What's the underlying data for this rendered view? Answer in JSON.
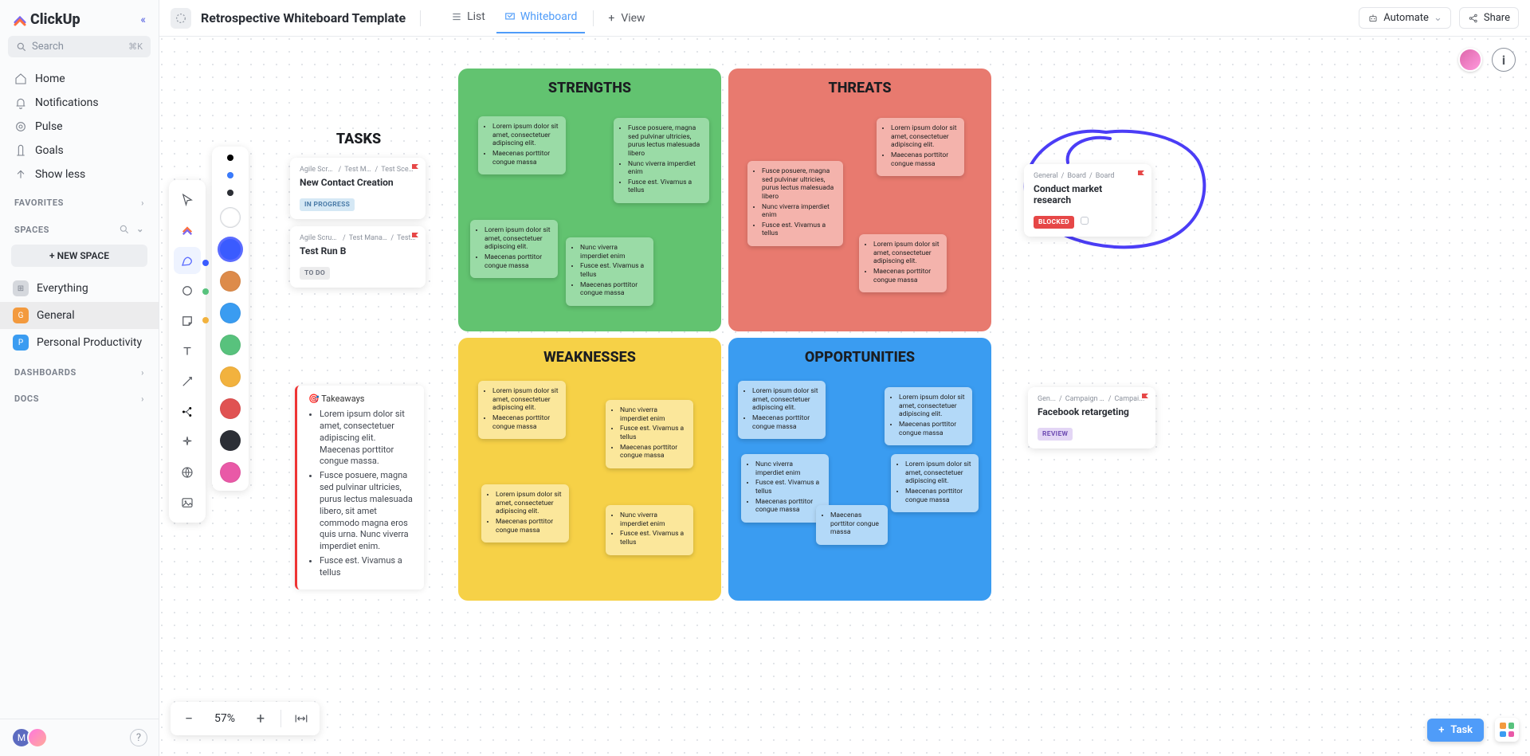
{
  "brand": "ClickUp",
  "search": {
    "placeholder": "Search",
    "shortcut": "⌘K"
  },
  "nav": {
    "home": "Home",
    "notifications": "Notifications",
    "pulse": "Pulse",
    "goals": "Goals",
    "showless": "Show less"
  },
  "sections": {
    "favorites": "FAVORITES",
    "spaces": "SPACES",
    "newspace": "+ NEW SPACE",
    "dashboards": "DASHBOARDS",
    "docs": "DOCS"
  },
  "spaces": {
    "everything": "Everything",
    "general": "General",
    "personal": "Personal Productivity"
  },
  "header": {
    "title": "Retrospective Whiteboard Template",
    "views": {
      "list": "List",
      "whiteboard": "Whiteboard",
      "add": "View"
    },
    "automate": "Automate",
    "share": "Share"
  },
  "zoom": {
    "value": "57%"
  },
  "fab": {
    "task": "Task"
  },
  "tasks": {
    "title": "TASKS",
    "card1": {
      "crumb1": "Agile Scrum ...",
      "crumb2": "Test Man...",
      "crumb3": "Test Scenari...",
      "title": "New Contact Creation",
      "status": "IN PROGRESS"
    },
    "card2": {
      "crumb1": "Agile Scrum Mana...",
      "crumb2": "Test Manag...",
      "crumb3": "Test ...",
      "title": "Test Run B",
      "status": "TO DO"
    }
  },
  "takeaways": {
    "label": "🎯 Takeaways",
    "b1": "Lorem ipsum dolor sit amet, consectetuer adipiscing elit. Maecenas porttitor congue massa.",
    "b2": "Fusce posuere, magna sed pulvinar ultricies, purus lectus malesuada libero, sit amet commodo magna eros quis urna. Nunc viverra imperdiet enim.",
    "b3": "Fusce est. Vivamus a tellus"
  },
  "quads": {
    "strengths": "STRENGTHS",
    "threats": "THREATS",
    "weaknesses": "WEAKNESSES",
    "opportunities": "OPPORTUNITIES"
  },
  "lorem": {
    "a": "Lorem ipsum dolor sit amet, consectetuer adipiscing elit.",
    "b": "Maecenas porttitor congue massa",
    "c": "Fusce posuere, magna sed pulvinar ultricies, purus lectus malesuada libero",
    "d": "Nunc viverra imperdiet enim",
    "e": "Fusce est. Vivamus a tellus"
  },
  "right_cards": {
    "c1": {
      "crumb1": "General",
      "crumb2": "Board",
      "crumb3": "Board",
      "title": "Conduct market research",
      "status": "BLOCKED"
    },
    "c2": {
      "crumb1": "Gen...",
      "crumb2": "Campaign Tracking & A...",
      "crumb3": "Campai...",
      "title": "Facebook retargeting",
      "status": "REVIEW"
    }
  },
  "colors": {
    "palette": [
      "#000000",
      "#3366ff",
      "#202020",
      "#ffffff",
      "#3366ff",
      "#dd8b4a",
      "#3a9cf1",
      "#58c27d",
      "#f2b23e",
      "#e05252",
      "#2c2f36",
      "#e959a7"
    ]
  }
}
